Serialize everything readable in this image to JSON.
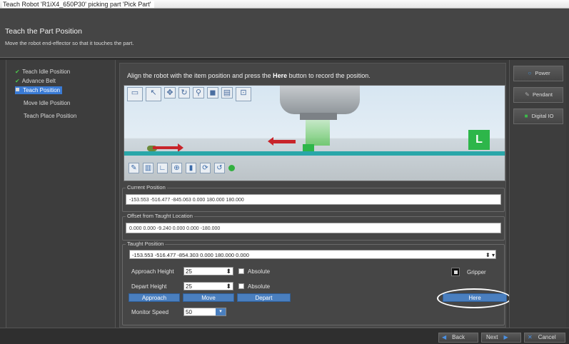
{
  "window": {
    "title": "Teach Robot 'R1iX4_650P30' picking part 'Pick Part'"
  },
  "header": {
    "title": "Teach the Part Position",
    "subtitle": "Move the robot end-effector so that it touches the part."
  },
  "steps": [
    {
      "label": "Teach Idle Position",
      "status": "done"
    },
    {
      "label": "Advance Belt",
      "status": "done"
    },
    {
      "label": "Teach Position",
      "status": "active"
    },
    {
      "label": "Move Idle Position",
      "status": "pending"
    },
    {
      "label": "Teach Place Position",
      "status": "pending"
    }
  ],
  "instruction": {
    "before": "Align the robot with the item position and press the ",
    "bold": "Here",
    "after": " button to record the position."
  },
  "viewport": {
    "marker_label": "L"
  },
  "current_position": {
    "label": "Current Position",
    "value": "-153.553 -516.477 -845.063 0.000 180.000 180.000"
  },
  "offset": {
    "label": "Offset from Taught Location",
    "value": "0.000 0.000 -9.240 0.000 0.000 -180.000"
  },
  "taught": {
    "label": "Taught Position",
    "value": "-153.553 -516.477 -854.303 0.000 180.000 0.000",
    "approach_height_label": "Approach Height",
    "approach_height": "25",
    "depart_height_label": "Depart Height",
    "depart_height": "25",
    "absolute_label": "Absolute",
    "gripper_label": "Gripper",
    "approach_button": "Approach",
    "move_button": "Move",
    "depart_button": "Depart",
    "here_button": "Here",
    "monitor_speed_label": "Monitor Speed",
    "monitor_speed": "50"
  },
  "right_panel": {
    "power": "Power",
    "pendant": "Pendant",
    "digital_io": "Digital IO"
  },
  "footer": {
    "back": "Back",
    "next": "Next",
    "cancel": "Cancel"
  },
  "colors": {
    "accent": "#3a7bd5",
    "button_blue": "#4a7fbf",
    "check_green": "#4cc44c",
    "part_green": "#2db64a",
    "arrow_red": "#c8242a",
    "belt_teal": "#2aa7a9"
  }
}
